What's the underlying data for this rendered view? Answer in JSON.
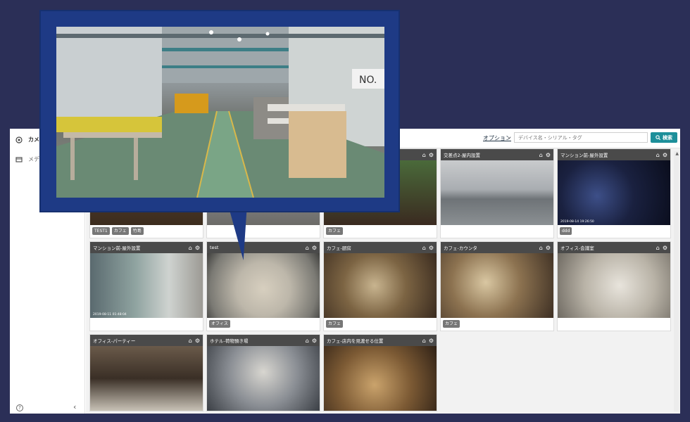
{
  "sidebar": {
    "items": [
      {
        "label": "カメ",
        "icon": "camera-icon"
      },
      {
        "label": "メデ",
        "icon": "media-icon"
      }
    ],
    "help_icon": "help-icon",
    "collapse_icon": "chevron-left-icon"
  },
  "topbar": {
    "options_label": "オプション",
    "search_placeholder": "デバイス名・シリアル・タグ",
    "search_button": "検索"
  },
  "cards": [
    {
      "title": "",
      "tags": [
        "TEST1",
        "カフェ",
        "竹島"
      ]
    },
    {
      "title": "",
      "tags": []
    },
    {
      "title": "",
      "tags": [
        "カフェ"
      ]
    },
    {
      "title": "交差点2-屋内設置",
      "tags": []
    },
    {
      "title": "マンション前-屋外設置",
      "tags": [
        "ddd"
      ],
      "timestamp": "2019-08-14 19:26:50"
    },
    {
      "title": "マンション前-屋外設置",
      "tags": [],
      "timestamp": "2019-08-11 01:48:04"
    },
    {
      "title": "test",
      "tags": [
        "オフィス"
      ]
    },
    {
      "title": "カフェ-厨房",
      "tags": [
        "カフェ"
      ]
    },
    {
      "title": "カフェ-カウンタ",
      "tags": [
        "カフェ"
      ]
    },
    {
      "title": "オフィス-会議室",
      "tags": []
    },
    {
      "title": "オフィス-パーティー",
      "tags": []
    },
    {
      "title": "ホテル-荷物預き場",
      "tags": []
    },
    {
      "title": "カフェ-店内を見渡せる位置",
      "tags": []
    }
  ],
  "colors": {
    "background": "#2b2f57",
    "popup": "#1e3a85",
    "search_button": "#1d8f9a",
    "card_header": "#4a4a4a"
  }
}
